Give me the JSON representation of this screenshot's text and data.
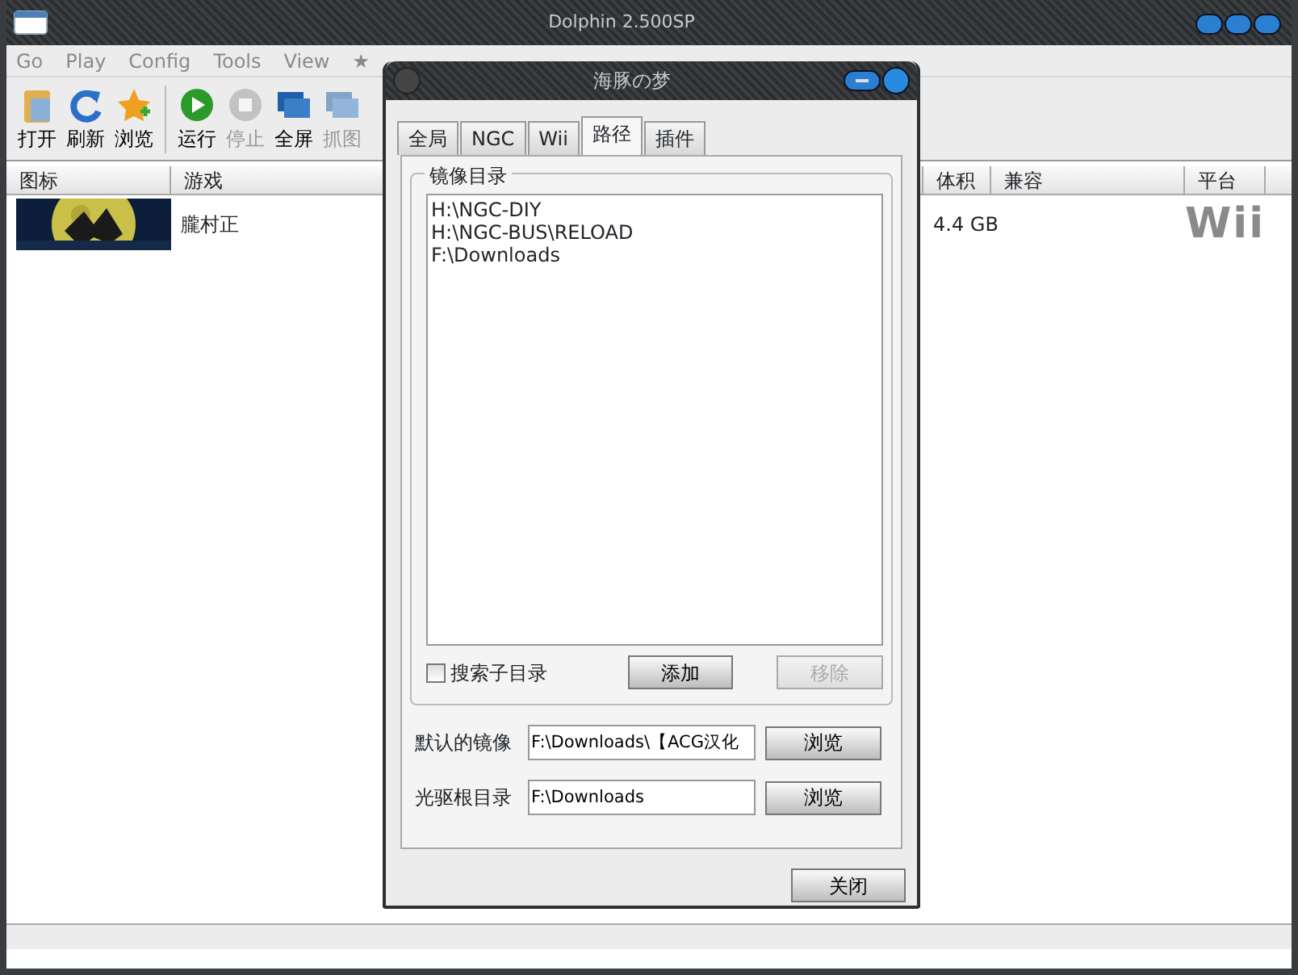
{
  "window": {
    "title": "Dolphin 2.500SP"
  },
  "menu": [
    "Go",
    "Play",
    "Config",
    "Tools",
    "View",
    "★"
  ],
  "toolbar": [
    [
      {
        "label": "打开",
        "disabled": false
      },
      {
        "label": "刷新",
        "disabled": false
      },
      {
        "label": "浏览",
        "disabled": false
      }
    ],
    [
      {
        "label": "运行",
        "disabled": false
      },
      {
        "label": "停止",
        "disabled": true
      },
      {
        "label": "全屏",
        "disabled": false
      },
      {
        "label": "抓图",
        "disabled": true
      }
    ]
  ],
  "game_list": {
    "columns": [
      "图标",
      "游戏",
      "体积",
      "兼容",
      "平台"
    ],
    "rows": [
      {
        "game": "朧村正",
        "size": "4.4 GB",
        "platform": "Wii"
      }
    ]
  },
  "dialog": {
    "title": "海豚の梦",
    "tabs": [
      {
        "label": "全局",
        "selected": false
      },
      {
        "label": "NGC",
        "selected": false
      },
      {
        "label": "Wii",
        "selected": false
      },
      {
        "label": "路径",
        "selected": true
      },
      {
        "label": "插件",
        "selected": false
      }
    ],
    "group_title": "镜像目录",
    "paths": [
      "H:\\NGC-DIY",
      "H:\\NGC-BUS\\RELOAD",
      "F:\\Downloads"
    ],
    "search_subdirs": {
      "label": "搜索子目录",
      "checked": false
    },
    "buttons": [
      {
        "label": "添加",
        "disabled": false
      },
      {
        "label": "移除",
        "disabled": true
      }
    ],
    "fields": [
      {
        "label": "默认的镜像",
        "value": "F:\\Downloads\\【ACG汉化",
        "button": "浏览"
      },
      {
        "label": "光驱根目录",
        "value": "F:\\Downloads",
        "button": "浏览"
      }
    ],
    "close": "关闭"
  }
}
